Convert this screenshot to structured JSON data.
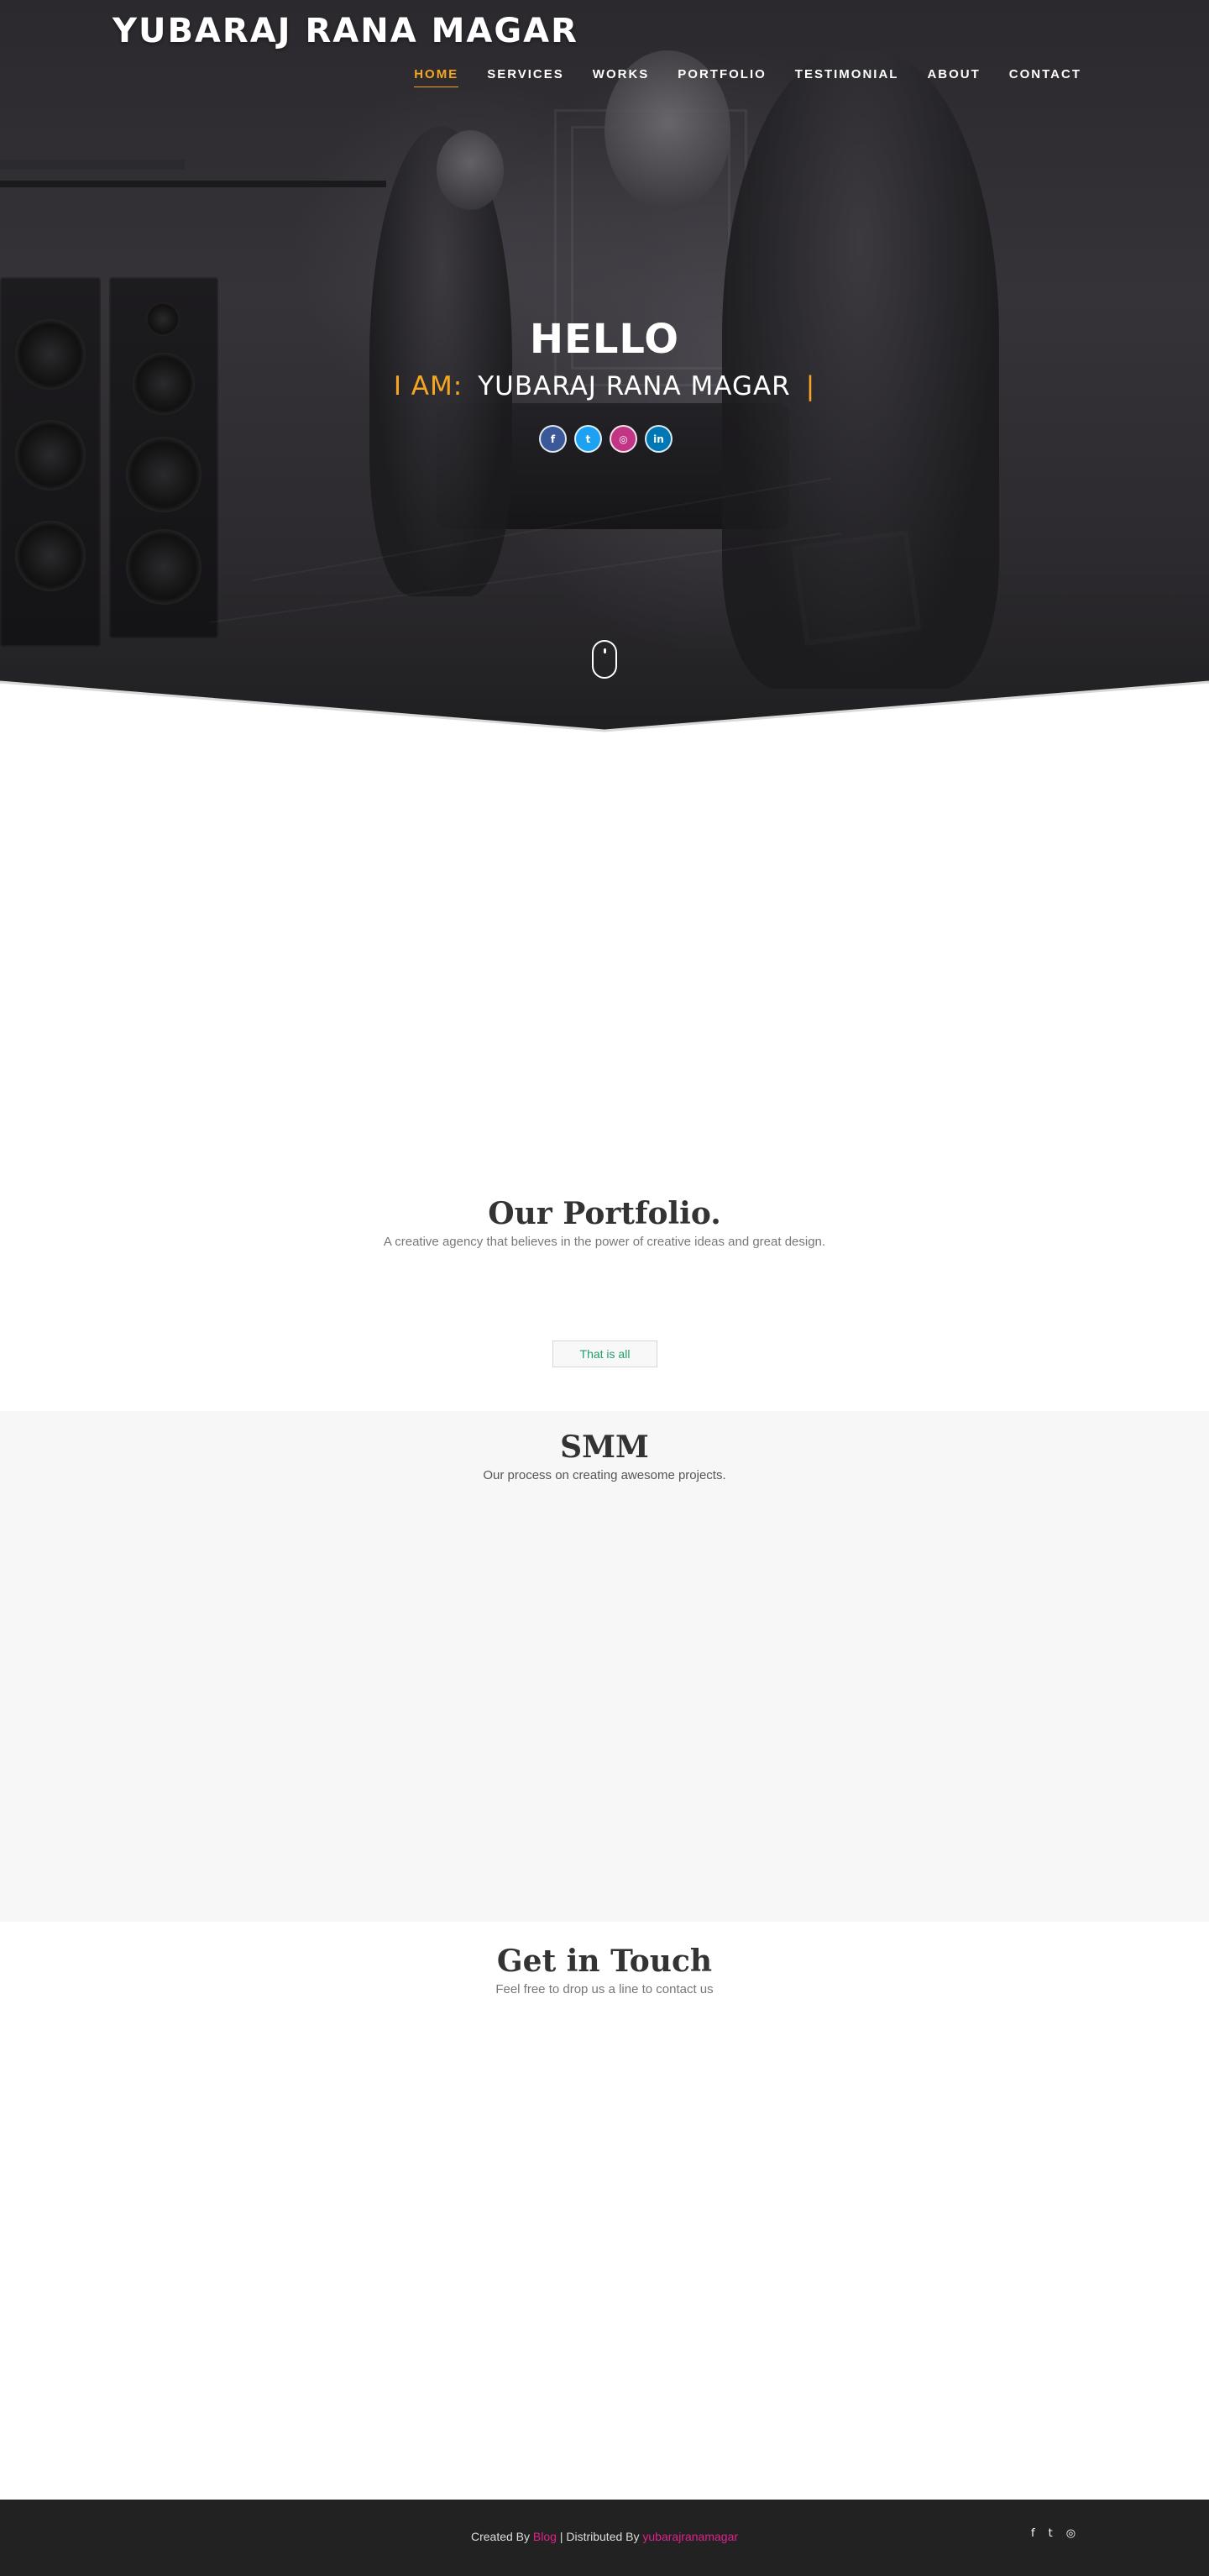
{
  "header": {
    "brand": "YUBARAJ RANA MAGAR",
    "nav": [
      {
        "label": "HOME",
        "active": true
      },
      {
        "label": "SERVICES"
      },
      {
        "label": "WORKS"
      },
      {
        "label": "PORTFOLIO"
      },
      {
        "label": "TESTIMONIAL"
      },
      {
        "label": "ABOUT"
      },
      {
        "label": "CONTACT"
      }
    ]
  },
  "hero": {
    "greeting": "HELLO",
    "iam_label": "I AM:",
    "name": "YUBARAJ RANA MAGAR",
    "cursor": "|",
    "social_icons": [
      {
        "name": "facebook-icon",
        "glyph": "f",
        "color": "#3b5998"
      },
      {
        "name": "twitter-icon",
        "glyph": "t",
        "color": "#1da1f2"
      },
      {
        "name": "instagram-icon",
        "glyph": "◎",
        "color": "#c13584"
      },
      {
        "name": "linkedin-icon",
        "glyph": "in",
        "color": "#0077b5"
      }
    ],
    "accent_color": "#f5a623"
  },
  "portfolio": {
    "title": "Our Portfolio.",
    "subtitle": "A creative agency that believes in the power of creative ideas and great design.",
    "button_label": "That is all"
  },
  "smm": {
    "title": "SMM",
    "subtitle": "Our process on creating awesome projects."
  },
  "contact": {
    "title": "Get in Touch",
    "subtitle": "Feel free to drop us a line to contact us"
  },
  "footer": {
    "created_by": "Created By",
    "blog_link": "Blog",
    "separator": "| Distributed By",
    "distributor_link": "yubarajranamagar",
    "icons": [
      {
        "name": "facebook-icon",
        "glyph": "f"
      },
      {
        "name": "twitter-icon",
        "glyph": "t"
      },
      {
        "name": "instagram-icon",
        "glyph": "◎"
      }
    ]
  }
}
